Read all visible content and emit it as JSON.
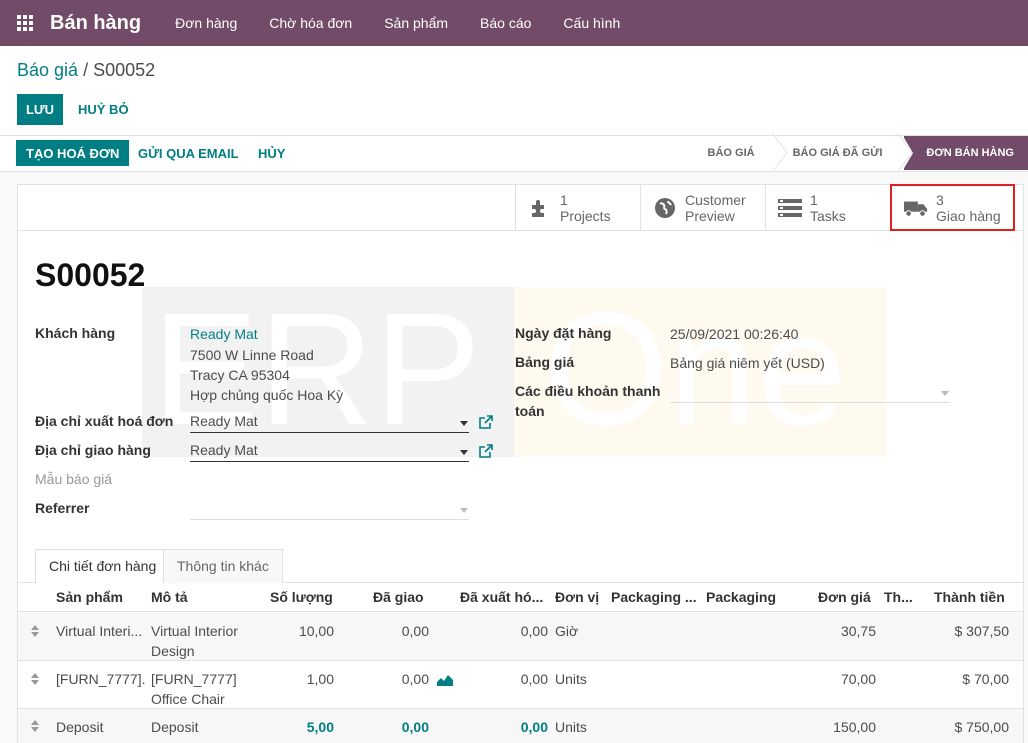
{
  "navbar": {
    "brand": "Bán hàng",
    "menu": [
      "Đơn hàng",
      "Chờ hóa đơn",
      "Sản phẩm",
      "Báo cáo",
      "Cấu hình"
    ]
  },
  "breadcrumb": {
    "parent": "Báo giá",
    "separator": " / ",
    "current": "S00052"
  },
  "actions": {
    "save": "LƯU",
    "discard": "HUỶ BỎ"
  },
  "statusbar": {
    "create_invoice": "TẠO HOÁ ĐƠN",
    "send_email": "GỬI QUA EMAIL",
    "cancel": "HỦY",
    "stages": [
      "BÁO GIÁ",
      "BÁO GIÁ ĐÃ GỬI",
      "ĐƠN BÁN HÀNG"
    ],
    "active_stage": "ĐƠN BÁN HÀNG"
  },
  "smart_buttons": [
    {
      "count": "1",
      "label": "Projects",
      "icon": "puzzle-icon"
    },
    {
      "count": "Customer",
      "label": "Preview",
      "icon": "globe-icon"
    },
    {
      "count": "1",
      "label": "Tasks",
      "icon": "tasks-icon"
    },
    {
      "count": "3",
      "label": "Giao hàng",
      "icon": "truck-icon"
    }
  ],
  "watermark": {
    "left": "ERP",
    "right": "One"
  },
  "form": {
    "name": "S00052",
    "customer_label": "Khách hàng",
    "customer_name": "Ready Mat",
    "customer_address": [
      "7500 W Linne Road",
      "Tracy CA 95304",
      "Hợp chủng quốc Hoa Kỳ"
    ],
    "invoice_address_label": "Địa chỉ xuất hoá đơn",
    "invoice_address": "Ready Mat",
    "delivery_address_label": "Địa chỉ giao hàng",
    "delivery_address": "Ready Mat",
    "template_label": "Mẫu báo giá",
    "referrer_label": "Referrer",
    "order_date_label": "Ngày đặt hàng",
    "order_date": "25/09/2021 00:26:40",
    "pricelist_label": "Bảng giá",
    "pricelist": "Bảng giá niêm yết (USD)",
    "payment_terms_label_1": "Các điều khoản thanh",
    "payment_terms_label_2": "toán"
  },
  "tabs": [
    "Chi tiết đơn hàng",
    "Thông tin khác"
  ],
  "table": {
    "headers": [
      "Sản phẩm",
      "Mô tả",
      "Số lượng",
      "Đã giao",
      "Đã xuất hó...",
      "Đơn vị",
      "Packaging ...",
      "Packaging",
      "Đơn giá",
      "Th...",
      "Thành tiền"
    ],
    "rows": [
      {
        "product": "Virtual Interi...",
        "desc_1": "Virtual Interior",
        "desc_2": "Design",
        "qty": "10,00",
        "delivered": "0,00",
        "invoiced": "0,00",
        "uom": "Giờ",
        "price": "30,75",
        "subtotal": "$ 307,50"
      },
      {
        "product": "[FURN_7777]...",
        "desc_1": "[FURN_7777]",
        "desc_2": "Office Chair",
        "qty": "1,00",
        "delivered": "0,00",
        "invoiced": "0,00",
        "uom": "Units",
        "price": "70,00",
        "subtotal": "$ 70,00"
      },
      {
        "product": "Deposit",
        "desc_1": "Deposit",
        "desc_2": "",
        "qty": "5,00",
        "delivered": "0,00",
        "invoiced": "0,00",
        "uom": "Units",
        "price": "150,00",
        "subtotal": "$ 750,00"
      }
    ]
  },
  "colors": {
    "brand": "#714b67",
    "accent": "#017e84",
    "highlight_border": "#e02020"
  }
}
